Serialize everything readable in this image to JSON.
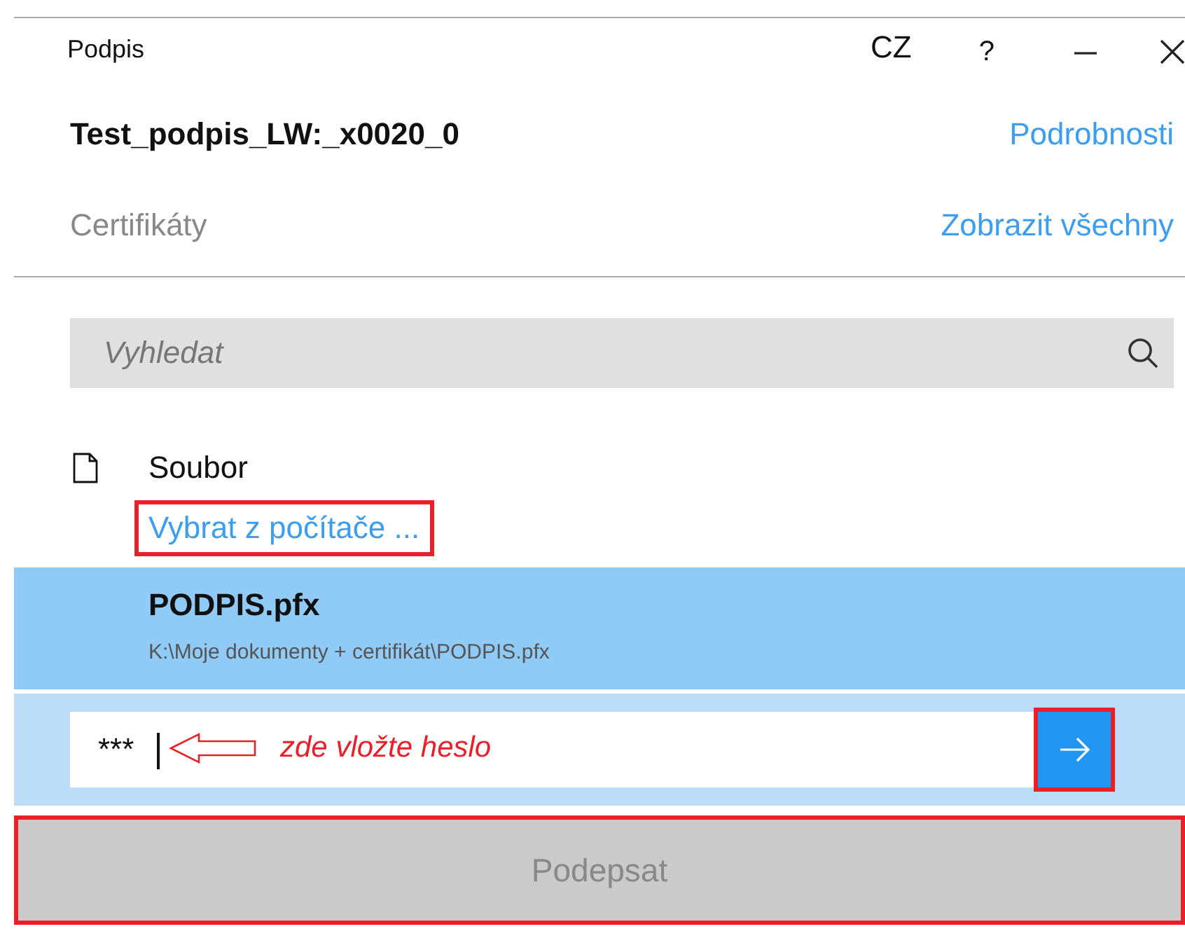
{
  "window": {
    "title": "Podpis",
    "language": "CZ",
    "help": "?"
  },
  "document": {
    "name": "Test_podpis_LW:_x0020_0",
    "details_link": "Podrobnosti"
  },
  "certificates": {
    "label": "Certifikáty",
    "show_all_link": "Zobrazit všechny"
  },
  "search": {
    "placeholder": "Vyhledat"
  },
  "file_source": {
    "label": "Soubor",
    "browse_link": "Vybrat z počítače ...",
    "highlighted": true
  },
  "certificate_item": {
    "name": "PODPIS.pfx",
    "path": "K:\\Moje dokumenty + certifikát\\PODPIS.pfx",
    "selected": true
  },
  "password": {
    "value": "***",
    "annotation": "zde vložte heslo",
    "submit_highlighted": true
  },
  "sign_button": {
    "label": "Podepsat",
    "disabled": true,
    "highlighted": true
  }
}
